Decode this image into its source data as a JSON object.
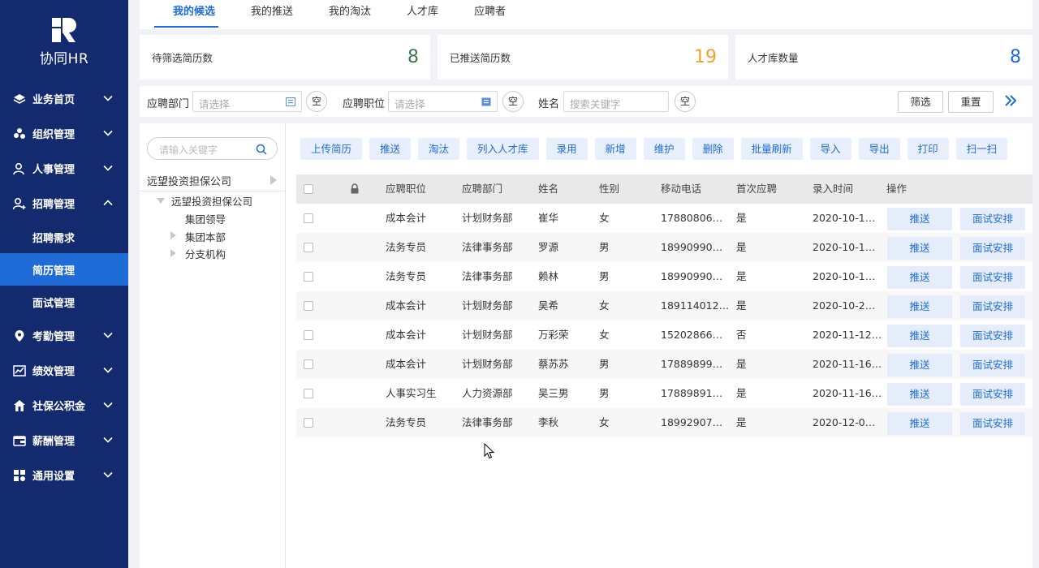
{
  "app": {
    "logo_text": "协同HR"
  },
  "sidebar": {
    "items": [
      {
        "label": "业务首页",
        "icon": "layers-icon"
      },
      {
        "label": "组织管理",
        "icon": "organization-icon"
      },
      {
        "label": "人事管理",
        "icon": "person-icon"
      },
      {
        "label": "招聘管理",
        "icon": "recruit-icon",
        "expanded": true,
        "children": [
          {
            "label": "招聘需求"
          },
          {
            "label": "简历管理",
            "active": true
          },
          {
            "label": "面试管理"
          }
        ]
      },
      {
        "label": "考勤管理",
        "icon": "location-pin-icon"
      },
      {
        "label": "绩效管理",
        "icon": "chart-icon"
      },
      {
        "label": "社保公积金",
        "icon": "home-shield-icon"
      },
      {
        "label": "薪酬管理",
        "icon": "wallet-icon"
      },
      {
        "label": "通用设置",
        "icon": "grid-settings-icon"
      }
    ]
  },
  "tabs": [
    "我的候选",
    "我的推送",
    "我的淘汰",
    "人才库",
    "应聘者"
  ],
  "stats": [
    {
      "label": "待筛选简历数",
      "value": "8",
      "color": "#3a7a4a"
    },
    {
      "label": "已推送简历数",
      "value": "19",
      "color": "#f0a22c"
    },
    {
      "label": "人才库数量",
      "value": "8",
      "color": "#1f6bd8"
    }
  ],
  "filter": {
    "dept_label": "应聘部门",
    "dept_placeholder": "请选择",
    "position_label": "应聘职位",
    "position_placeholder": "请选择",
    "name_label": "姓名",
    "name_placeholder": "搜索关键字",
    "clear_label": "空",
    "filter_button": "筛选",
    "reset_button": "重置"
  },
  "tree": {
    "search_placeholder": "请输入关键字",
    "root": "远望投资担保公司",
    "child": "远望投资担保公司",
    "nodes": [
      "集团领导",
      "集团本部",
      "分支机构"
    ]
  },
  "toolbar": [
    "上传简历",
    "推送",
    "淘汰",
    "列入人才库",
    "录用",
    "新增",
    "维护",
    "删除",
    "批量刷新",
    "导入",
    "导出",
    "打印",
    "扫一扫"
  ],
  "table": {
    "headers": [
      "应聘职位",
      "应聘部门",
      "姓名",
      "性别",
      "移动电话",
      "首次应聘",
      "录入时间",
      "操作"
    ],
    "action_push": "推送",
    "action_interview": "面试安排",
    "rows": [
      [
        "成本会计",
        "计划财务部",
        "崔华",
        "女",
        "17880806…",
        "是",
        "2020-10-1…"
      ],
      [
        "法务专员",
        "法律事务部",
        "罗源",
        "男",
        "18990990…",
        "是",
        "2020-10-1…"
      ],
      [
        "法务专员",
        "法律事务部",
        "赖林",
        "男",
        "18990990…",
        "是",
        "2020-10-1…"
      ],
      [
        "成本会计",
        "计划财务部",
        "吴希",
        "女",
        "189114012…",
        "是",
        "2020-10-2…"
      ],
      [
        "成本会计",
        "计划财务部",
        "万彩荣",
        "女",
        "15202866…",
        "否",
        "2020-11-12…"
      ],
      [
        "成本会计",
        "计划财务部",
        "蔡苏苏",
        "男",
        "17889899…",
        "是",
        "2020-11-16…"
      ],
      [
        "人事实习生",
        "人力资源部",
        "吴三男",
        "男",
        "17889891…",
        "是",
        "2020-11-16…"
      ],
      [
        "法务专员",
        "法律事务部",
        "李秋",
        "女",
        "18992907…",
        "是",
        "2020-12-0…"
      ]
    ]
  }
}
